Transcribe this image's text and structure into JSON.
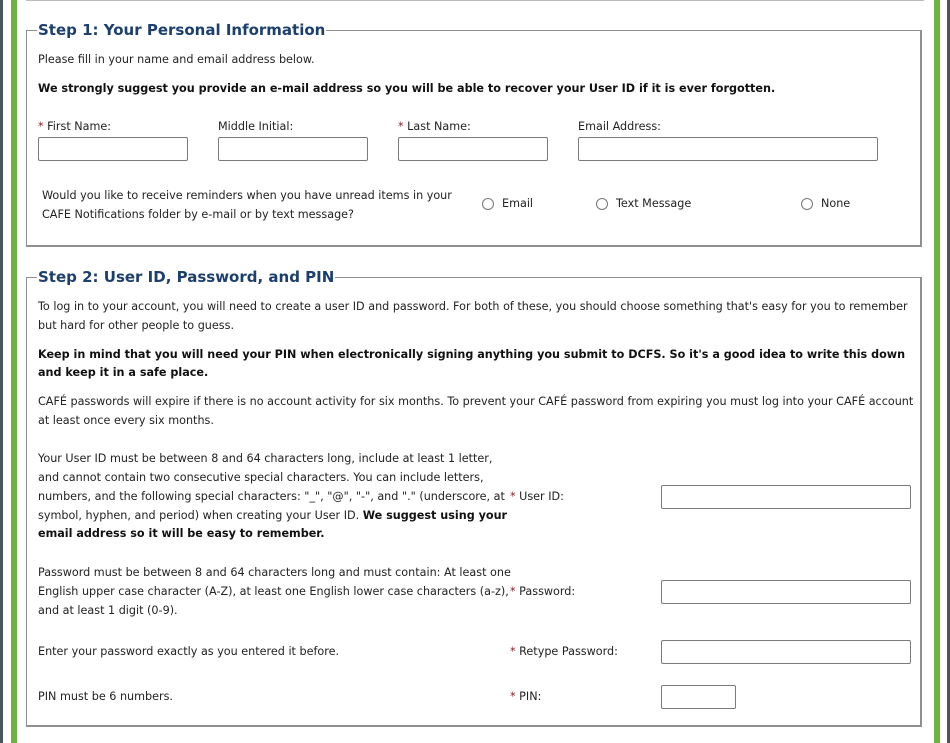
{
  "colors": {
    "accent_green": "#6db33f",
    "legend_blue": "#1c3f6e",
    "required_red": "#8b1a2a"
  },
  "step1": {
    "legend": "Step 1: Your Personal Information",
    "intro": "Please fill in your name and email address below.",
    "strong_note": "We strongly suggest you provide an e-mail address so you will be able to recover your User ID if it is ever forgotten.",
    "required_marker": "*",
    "fields": {
      "first_name": {
        "label": "First Name:",
        "required": true,
        "value": ""
      },
      "middle_initial": {
        "label": "Middle Initial:",
        "required": false,
        "value": ""
      },
      "last_name": {
        "label": "Last Name:",
        "required": true,
        "value": ""
      },
      "email": {
        "label": "Email Address:",
        "required": false,
        "value": ""
      }
    },
    "reminder_question_line1": "Would you like to receive reminders when you have unread items in your",
    "reminder_question_line2": "CAFE Notifications folder by e-mail or by text message?",
    "reminder_options": [
      {
        "label": "Email",
        "selected": false
      },
      {
        "label": "Text Message",
        "selected": false
      },
      {
        "label": "None",
        "selected": false
      }
    ]
  },
  "step2": {
    "legend": "Step 2: User ID, Password, and PIN",
    "intro_line1": "To log in to your account, you will need to create a user ID and password. For both of these, you should choose something that's easy for you to remember",
    "intro_line2": "but hard for other people to guess.",
    "pin_note_line1": "Keep in mind that you will need your PIN when electronically signing anything you submit to DCFS. So it's a good idea to write this down",
    "pin_note_line2": "and keep it in a safe place.",
    "expire_line1": "CAFÉ passwords will expire if there is no account activity for six months. To prevent your CAFÉ password from expiring you must log into your CAFÉ account",
    "expire_line2": "at least once every six months.",
    "required_marker": "*",
    "userid": {
      "help_line1": "Your User ID must be between 8 and 64 characters long, include at least 1 letter,",
      "help_line2": "and cannot contain two consecutive special characters. You can include letters,",
      "help_line3": "numbers, and the following special characters: \"_\", \"@\", \"-\", and \".\" (underscore, at",
      "help_line4_normal": "symbol, hyphen, and period) when creating your User ID. ",
      "help_line4_bold": "We suggest using your",
      "help_line5_bold": "email address so it will be easy to remember.",
      "label": "User ID:",
      "value": ""
    },
    "password": {
      "help_line1": "Password must be between 8 and 64 characters long and must contain: At least one",
      "help_line2": "English upper case character (A-Z), at least one English lower case characters (a-z),",
      "help_line3": "and at least 1 digit (0-9).",
      "label": "Password:",
      "value": ""
    },
    "retype": {
      "help": "Enter your password exactly as you entered it before.",
      "label": "Retype Password:",
      "value": ""
    },
    "pin": {
      "help": "PIN must be 6 numbers.",
      "label": "PIN:",
      "value": ""
    }
  }
}
